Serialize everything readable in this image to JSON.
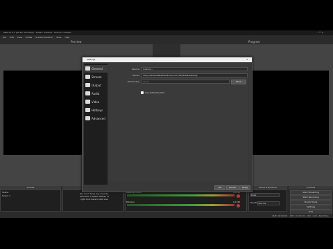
{
  "window": {
    "title": "OBS 27.0.1 (64-bit, windows) - Profile: Untitled - Scenes: Untitled"
  },
  "menu": [
    "File",
    "Edit",
    "View",
    "Profile",
    "Scene Collection",
    "Tools",
    "Help"
  ],
  "preview_label": "Preview",
  "program_label": "Program",
  "settings": {
    "title": "Settings",
    "sidebar": [
      {
        "label": "General",
        "icon": "gear-icon"
      },
      {
        "label": "Stream",
        "icon": "globe-icon"
      },
      {
        "label": "Output",
        "icon": "output-icon"
      },
      {
        "label": "Audio",
        "icon": "speaker-icon"
      },
      {
        "label": "Video",
        "icon": "monitor-icon"
      },
      {
        "label": "Hotkeys",
        "icon": "keyboard-icon"
      },
      {
        "label": "Advanced",
        "icon": "tools-icon"
      }
    ],
    "fields": {
      "service_label": "Service",
      "service_value": "Custom...",
      "server_label": "Server",
      "server_value": "rtmp://streamlabs/tiktok-live.com:443/thestreamkey",
      "streamkey_label": "Stream Key",
      "streamkey_value": "•••••",
      "show_button": "Show",
      "auth_checkbox": "Use authentication"
    },
    "buttons": {
      "ok": "OK",
      "cancel": "Cancel",
      "apply": "Apply"
    }
  },
  "docks": {
    "scenes": {
      "title": "Scenes",
      "items": [
        "Scene",
        "Scene 1"
      ]
    },
    "sources": {
      "title": "Sources",
      "empty_text": "You don't have any sources. Click the + button below, or right click here to add one."
    },
    "mixer": {
      "title": "Audio Mixer",
      "channels": [
        {
          "name": "Desktop Audio",
          "db": "0.0 dB"
        },
        {
          "name": "Mic/Aux",
          "db": "0.0 dB"
        }
      ]
    },
    "transitions": {
      "title": "Scene Transitions",
      "type": "Fade",
      "duration_label": "Duration",
      "duration_value": "300 ms"
    },
    "controls": {
      "title": "Controls",
      "buttons": [
        "Start Streaming",
        "Start Recording",
        "Studio Mode",
        "Settings",
        "Exit"
      ]
    }
  },
  "status": {
    "live": "LIVE: 00:00:00",
    "rec": "REC: 00:00:00",
    "cpu": "CPU: 1.2%, 60.00 fps"
  }
}
